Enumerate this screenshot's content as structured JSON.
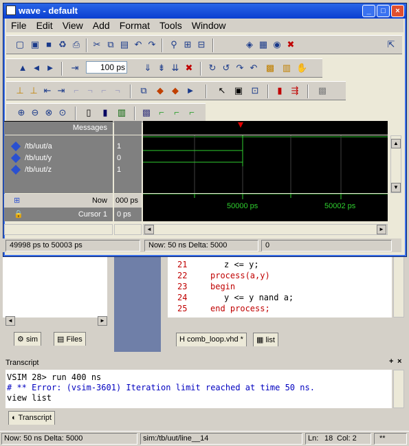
{
  "window": {
    "title": "wave - default"
  },
  "menu": [
    "File",
    "Edit",
    "View",
    "Add",
    "Format",
    "Tools",
    "Window"
  ],
  "toolbar": {
    "zoom_value": "100 ps"
  },
  "wave": {
    "messages_header": "Messages",
    "signals": [
      {
        "name": "/tb/uut/a",
        "value": "1"
      },
      {
        "name": "/tb/uut/y",
        "value": "0"
      },
      {
        "name": "/tb/uut/z",
        "value": "1"
      }
    ],
    "now_label": "Now",
    "now_value": "000 ps",
    "cursor_label": "Cursor 1",
    "cursor_value": "0 ps",
    "ticks": [
      "50000 ps",
      "50002 ps"
    ],
    "status_range": "49998 ps to 50003 ps",
    "status_now": "Now: 50 ns  Delta: 5000",
    "status_extra": "0"
  },
  "source": {
    "lines": [
      {
        "num": "21",
        "text": "z <= y;"
      },
      {
        "num": "22",
        "text": "process(a,y)"
      },
      {
        "num": "23",
        "text": "begin"
      },
      {
        "num": "24",
        "text": "y <= y nand a;"
      },
      {
        "num": "25",
        "text": "end process;"
      }
    ],
    "tab_file": "comb_loop.vhd *",
    "tab_list": "list"
  },
  "left_tabs": {
    "sim": "sim",
    "files": "Files"
  },
  "transcript": {
    "title": "Transcript",
    "lines": [
      "VSIM 28> run 400 ns",
      "# ** Error: (vsim-3601) Iteration limit reached at time 50 ns.",
      "view list"
    ],
    "tab": "Transcript"
  },
  "statusbar": {
    "now": "Now: 50 ns  Delta: 5000",
    "path": "sim:/tb/uut/line__14",
    "ln": "Ln:",
    "ln_val": "18",
    "col": "Col: 2",
    "extra": "**"
  }
}
